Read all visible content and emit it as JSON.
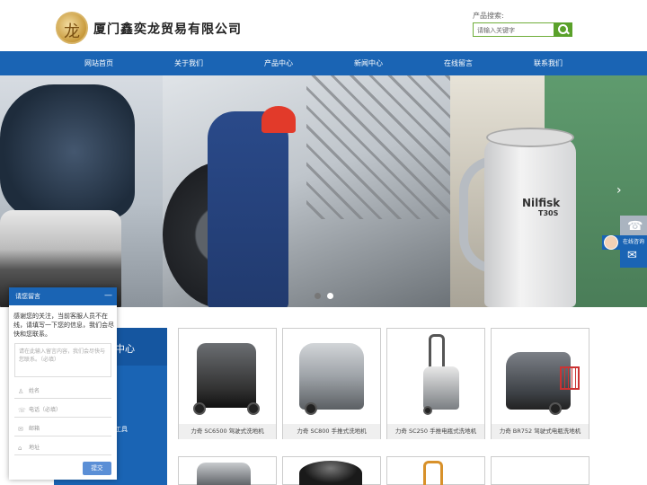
{
  "header": {
    "company_name": "厦门鑫奕龙贸易有限公司",
    "search_label": "产品搜索:",
    "search_placeholder": "请输入关键字"
  },
  "nav": [
    "网站首页",
    "关于我们",
    "产品中心",
    "新闻中心",
    "在线留言",
    "联系我们"
  ],
  "banner": {
    "brand": "Nilfisk",
    "model": "T30S",
    "slide_count": 2,
    "active_slide": 2
  },
  "float_bar": {
    "chat_label": "在线咨询"
  },
  "sidebar": {
    "title_fragment": "中心",
    "item_fragment": "工具"
  },
  "products": [
    {
      "caption": "力奇 SC6500 驾驶式洗地机"
    },
    {
      "caption": "力奇 SC800 手推式洗地机"
    },
    {
      "caption": "力奇 SC250 手推电瓶式洗地机"
    },
    {
      "caption": "力奇 BR752 驾驶式电瓶洗地机"
    }
  ],
  "chat": {
    "title": "请您留言",
    "minimize": "—",
    "message": "感谢您的关注，当前客服人员不在线，请填写一下您的信息，我们会尽快和您联系。",
    "textarea_placeholder": "请在此输入留言内容，我们会尽快与您联系。（必填）",
    "fields": [
      {
        "icon": "user-icon",
        "placeholder": "姓名"
      },
      {
        "icon": "phone-icon",
        "placeholder": "电话（必填）"
      },
      {
        "icon": "mail-icon",
        "placeholder": "邮箱"
      },
      {
        "icon": "location-icon",
        "placeholder": "地址"
      }
    ],
    "submit": "提交"
  }
}
